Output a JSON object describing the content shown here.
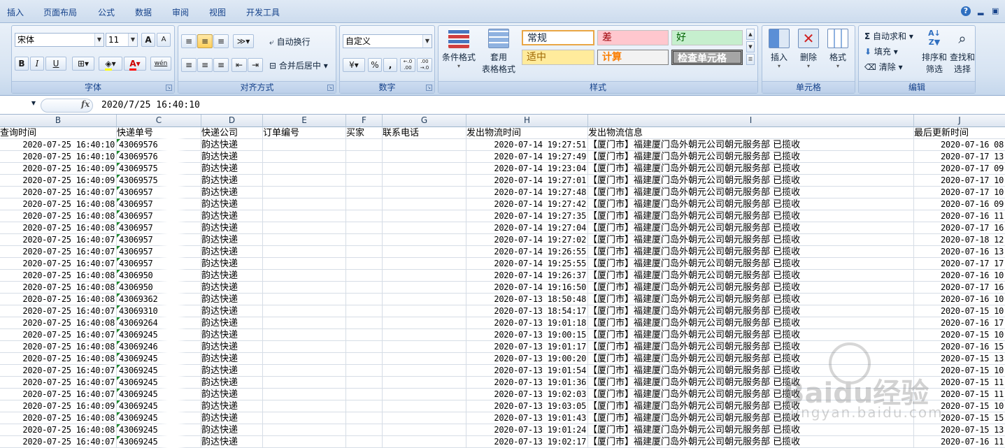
{
  "menu": {
    "tabs": [
      "插入",
      "页面布局",
      "公式",
      "数据",
      "审阅",
      "视图",
      "开发工具"
    ],
    "help": "?"
  },
  "ribbon": {
    "font": {
      "name": "宋体",
      "size": "11",
      "bold": "B",
      "italic": "I",
      "underline": "U",
      "grow": "A",
      "shrink": "A",
      "wen": "wén",
      "label": "字体"
    },
    "alignment": {
      "wrap": "自动换行",
      "merge": "合并后居中",
      "label": "对齐方式"
    },
    "number": {
      "format": "自定义",
      "percent": "%",
      "comma": ",",
      "inc": "←.0 .00",
      "dec": ".00 →.0",
      "label": "数字"
    },
    "styles": {
      "conditional": "条件格式",
      "table_a": "套用",
      "table_b": "表格格式",
      "normal": "常规",
      "bad": "差",
      "good": "好",
      "neutral": "适中",
      "calc": "计算",
      "check": "检查单元格",
      "label": "样式"
    },
    "cells": {
      "insert": "插入",
      "delete": "删除",
      "format": "格式",
      "label": "单元格"
    },
    "editing": {
      "autosum": "自动求和",
      "fill": "填充",
      "clear": "清除",
      "sort_a": "排序和",
      "sort_b": "筛选",
      "find_a": "查找和",
      "find_b": "选择",
      "label": "编辑"
    }
  },
  "formula_bar": {
    "fx": "fx",
    "value": "2020/7/25  16:40:10"
  },
  "columns": [
    "B",
    "C",
    "D",
    "E",
    "F",
    "G",
    "H",
    "I",
    "J"
  ],
  "headers": [
    "查询时间",
    "快递单号",
    "快递公司",
    "订单编号",
    "买家",
    "联系电话",
    "发出物流时间",
    "发出物流信息",
    "最后更新时间"
  ],
  "rows": [
    [
      "2020-07-25 16:40:10",
      "43069576",
      "韵达快递",
      "2020-07-14 19:27:51",
      "2020-07-16 08"
    ],
    [
      "2020-07-25 16:40:10",
      "43069576",
      "韵达快递",
      "2020-07-14 19:27:49",
      "2020-07-17 13"
    ],
    [
      "2020-07-25 16:40:09",
      "43069575",
      "韵达快递",
      "2020-07-14 19:23:04",
      "2020-07-17 09"
    ],
    [
      "2020-07-25 16:40:09",
      "43069575",
      "韵达快递",
      "2020-07-14 19:27:01",
      "2020-07-17 10"
    ],
    [
      "2020-07-25 16:40:07",
      "4306957",
      "韵达快递",
      "2020-07-14 19:27:48",
      "2020-07-17 10"
    ],
    [
      "2020-07-25 16:40:08",
      "4306957",
      "韵达快递",
      "2020-07-14 19:27:42",
      "2020-07-16 09"
    ],
    [
      "2020-07-25 16:40:08",
      "4306957",
      "韵达快递",
      "2020-07-14 19:27:35",
      "2020-07-16 11"
    ],
    [
      "2020-07-25 16:40:08",
      "4306957",
      "韵达快递",
      "2020-07-14 19:27:04",
      "2020-07-17 16"
    ],
    [
      "2020-07-25 16:40:07",
      "4306957",
      "韵达快递",
      "2020-07-14 19:27:02",
      "2020-07-18 12"
    ],
    [
      "2020-07-25 16:40:07",
      "4306957",
      "韵达快递",
      "2020-07-14 19:26:55",
      "2020-07-16 13"
    ],
    [
      "2020-07-25 16:40:07",
      "4306957",
      "韵达快递",
      "2020-07-14 19:25:55",
      "2020-07-17 17"
    ],
    [
      "2020-07-25 16:40:08",
      "4306950",
      "韵达快递",
      "2020-07-14 19:26:37",
      "2020-07-16 10"
    ],
    [
      "2020-07-25 16:40:08",
      "4306950",
      "韵达快递",
      "2020-07-14 19:16:50",
      "2020-07-17 16"
    ],
    [
      "2020-07-25 16:40:08",
      "43069362",
      "韵达快递",
      "2020-07-13 18:50:48",
      "2020-07-16 10"
    ],
    [
      "2020-07-25 16:40:07",
      "43069310",
      "韵达快递",
      "2020-07-13 18:54:17",
      "2020-07-15 10"
    ],
    [
      "2020-07-25 16:40:08",
      "43069264",
      "韵达快递",
      "2020-07-13 19:01:18",
      "2020-07-16 17"
    ],
    [
      "2020-07-25 16:40:07",
      "43069245",
      "韵达快递",
      "2020-07-13 19:00:15",
      "2020-07-15 10"
    ],
    [
      "2020-07-25 16:40:08",
      "43069246",
      "韵达快递",
      "2020-07-13 19:01:17",
      "2020-07-16 15"
    ],
    [
      "2020-07-25 16:40:08",
      "43069245",
      "韵达快递",
      "2020-07-13 19:00:20",
      "2020-07-15 13"
    ],
    [
      "2020-07-25 16:40:07",
      "43069245",
      "韵达快递",
      "2020-07-13 19:01:54",
      "2020-07-15 10"
    ],
    [
      "2020-07-25 16:40:07",
      "43069245",
      "韵达快递",
      "2020-07-13 19:01:36",
      "2020-07-15 11"
    ],
    [
      "2020-07-25 16:40:07",
      "43069245",
      "韵达快递",
      "2020-07-13 19:02:03",
      "2020-07-15 11"
    ],
    [
      "2020-07-25 16:40:09",
      "43069245",
      "韵达快递",
      "2020-07-13 19:03:05",
      "2020-07-15 10"
    ],
    [
      "2020-07-25 16:40:08",
      "43069245",
      "韵达快递",
      "2020-07-13 19:01:43",
      "2020-07-15 15"
    ],
    [
      "2020-07-25 16:40:08",
      "43069245",
      "韵达快递",
      "2020-07-13 19:01:24",
      "2020-07-15 13"
    ],
    [
      "2020-07-25 16:40:07",
      "43069245",
      "韵达快递",
      "2020-07-13 19:02:17",
      "2020-07-16 11"
    ]
  ],
  "logistics_info": "【厦门市】福建厦门岛外朝元公司朝元服务部 已揽收",
  "watermark": {
    "line1": "Baidu经验",
    "line2": "jingyan.baidu.com"
  },
  "colors": {
    "accent": "#15428b",
    "style_bad": "#ffc7ce",
    "style_good": "#c6efce",
    "style_neutral": "#ffeb9c",
    "style_calc_text": "#fa7d00"
  }
}
